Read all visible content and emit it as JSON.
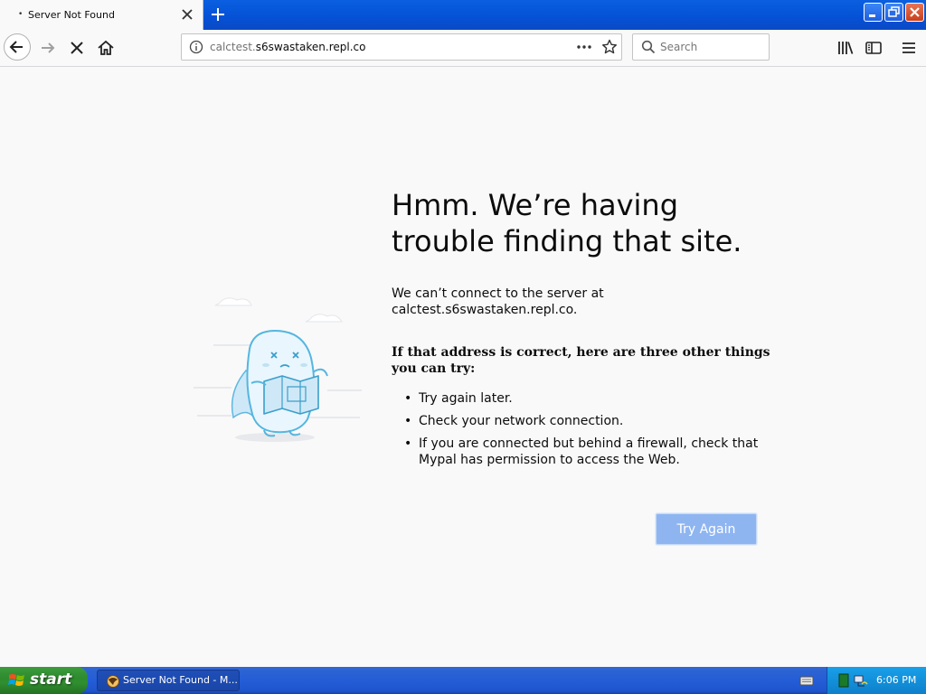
{
  "window": {
    "title": "Server Not Found"
  },
  "tab": {
    "title": "Server Not Found"
  },
  "nav": {
    "url_host": "calctest.",
    "url_domain": "s6swastaken.repl.co"
  },
  "search": {
    "placeholder": "Search"
  },
  "error": {
    "title": "Hmm. We’re having trouble finding that site.",
    "desc_line1": "We can’t connect to the server at",
    "desc_line2": "calctest.s6swastaken.repl.co.",
    "suggest_heading": "If that address is correct, here are three other things you can try:",
    "suggestions": [
      "Try again later.",
      "Check your network connection.",
      "If you are connected but behind a firewall, check that Mypal has permission to access the Web."
    ],
    "try_again_label": "Try Again"
  },
  "taskbar": {
    "start_label": "start",
    "task_label": "Server Not Found - M...",
    "clock": "6:06 PM"
  },
  "colors": {
    "accent": "#0a84ff",
    "try_again_bg": "#8fb5f1",
    "titlebar": "#0551d6",
    "start_green": "#2e8b2e"
  }
}
